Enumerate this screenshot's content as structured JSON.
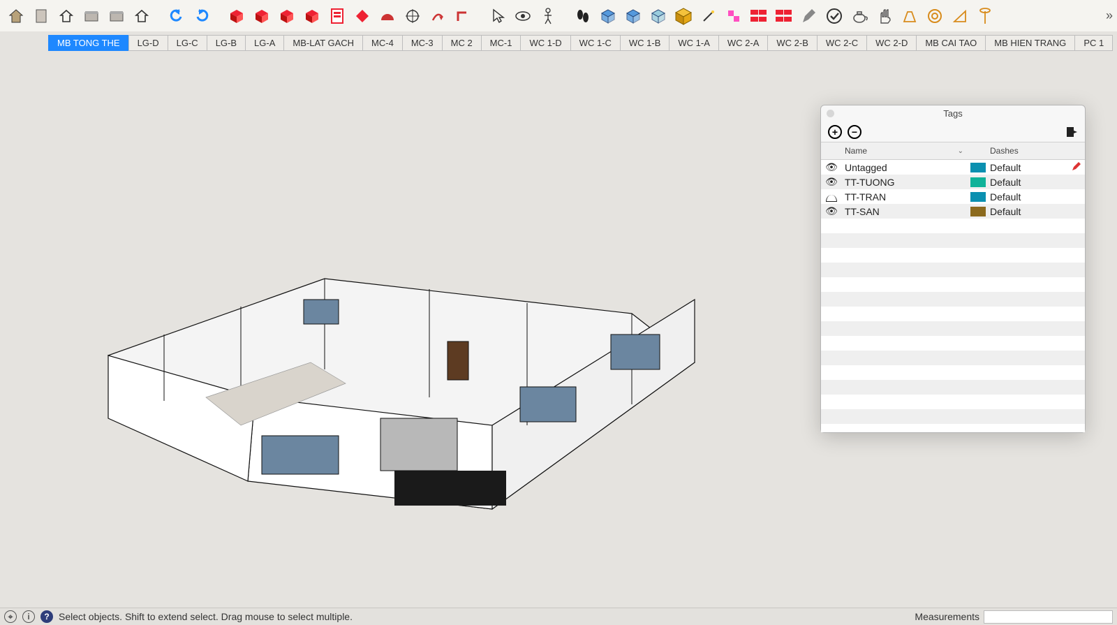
{
  "toolbar": {
    "icons": [
      {
        "name": "model-icon",
        "fill": "#b8a27a",
        "type": "house"
      },
      {
        "name": "open-icon",
        "fill": "#ccc5bc",
        "type": "sheet"
      },
      {
        "name": "home-icon",
        "fill": "#444",
        "type": "house-outline"
      },
      {
        "name": "folder-icon",
        "fill": "#bdb7b0",
        "type": "box"
      },
      {
        "name": "box-icon",
        "fill": "#bdb7b0",
        "type": "box"
      },
      {
        "name": "house-outline-icon",
        "fill": "#444",
        "type": "house-outline"
      },
      {
        "name": "sep"
      },
      {
        "name": "undo-icon",
        "fill": "#1e88ff",
        "type": "arrow-ccw"
      },
      {
        "name": "redo-icon",
        "fill": "#1e88ff",
        "type": "arrow-cw"
      },
      {
        "name": "sep"
      },
      {
        "name": "material-red-icon",
        "fill": "#e23",
        "type": "cube-red"
      },
      {
        "name": "material-green-icon",
        "fill": "#e23",
        "type": "cube-plus"
      },
      {
        "name": "refresh-material-icon",
        "fill": "#e23",
        "type": "cube-arrow"
      },
      {
        "name": "delete-material-icon",
        "fill": "#e23",
        "type": "cube-x"
      },
      {
        "name": "document-red-icon",
        "fill": "#e23",
        "type": "sheet-red"
      },
      {
        "name": "diamond-red-icon",
        "fill": "#e23",
        "type": "diamond"
      },
      {
        "name": "semi-circle-icon",
        "fill": "#c33",
        "type": "semi"
      },
      {
        "name": "target-icon",
        "fill": "#333",
        "type": "target"
      },
      {
        "name": "motion-icon",
        "fill": "#c33",
        "type": "swirl"
      },
      {
        "name": "corner-icon",
        "fill": "#c33",
        "type": "corner"
      },
      {
        "name": "sep"
      },
      {
        "name": "cursor-icon",
        "fill": "#555",
        "type": "cursor"
      },
      {
        "name": "eye-icon",
        "fill": "#555",
        "type": "eye"
      },
      {
        "name": "figure-icon",
        "fill": "#555",
        "type": "figure"
      },
      {
        "name": "sep"
      },
      {
        "name": "footprints-icon",
        "fill": "#222",
        "type": "foot"
      },
      {
        "name": "cube-blue-icon",
        "fill": "#59d",
        "type": "cube-wire"
      },
      {
        "name": "cube-down-icon",
        "fill": "#59d",
        "type": "cube-wire"
      },
      {
        "name": "cube-light-icon",
        "fill": "#9cd",
        "type": "cube-wire"
      },
      {
        "name": "cube-gold-icon",
        "fill": "#e6a817",
        "type": "cube-solid"
      },
      {
        "name": "wand-icon",
        "fill": "#333",
        "type": "wand"
      },
      {
        "name": "pink-boxes-icon",
        "fill": "#ff4fc1",
        "type": "pink"
      },
      {
        "name": "bricks-icon",
        "fill": "#e23",
        "type": "bricks"
      },
      {
        "name": "bricks-arrow-icon",
        "fill": "#e23",
        "type": "bricks"
      },
      {
        "name": "pen-icon",
        "fill": "#888",
        "type": "pen"
      },
      {
        "name": "check-circle-icon",
        "fill": "#333",
        "type": "check"
      },
      {
        "name": "teapot-icon",
        "fill": "#555",
        "type": "teapot"
      },
      {
        "name": "hand-icon",
        "fill": "#555",
        "type": "hand"
      },
      {
        "name": "perspective-icon",
        "fill": "#d88b1b",
        "type": "persp"
      },
      {
        "name": "ring-icon",
        "fill": "#d88b1b",
        "type": "ring"
      },
      {
        "name": "triangle-icon",
        "fill": "#d88b1b",
        "type": "tri"
      },
      {
        "name": "pin-icon",
        "fill": "#d88b1b",
        "type": "pin"
      }
    ]
  },
  "scenes": {
    "tabs": [
      {
        "label": "MB TONG THE",
        "active": true
      },
      {
        "label": "LG-D"
      },
      {
        "label": "LG-C"
      },
      {
        "label": "LG-B"
      },
      {
        "label": "LG-A"
      },
      {
        "label": "MB-LAT GACH"
      },
      {
        "label": "MC-4"
      },
      {
        "label": "MC-3"
      },
      {
        "label": "MC 2"
      },
      {
        "label": "MC-1"
      },
      {
        "label": "WC 1-D"
      },
      {
        "label": "WC 1-C"
      },
      {
        "label": "WC 1-B"
      },
      {
        "label": "WC 1-A"
      },
      {
        "label": "WC 2-A"
      },
      {
        "label": "WC 2-B"
      },
      {
        "label": "WC 2-C"
      },
      {
        "label": "WC 2-D"
      },
      {
        "label": "MB CAI TAO"
      },
      {
        "label": "MB HIEN TRANG"
      },
      {
        "label": "PC 1"
      }
    ]
  },
  "tagsPanel": {
    "title": "Tags",
    "headers": {
      "name": "Name",
      "dashes": "Dashes"
    },
    "rows": [
      {
        "visible": true,
        "name": "Untagged",
        "color": "#0b90b0",
        "dashes": "Default",
        "editing": true
      },
      {
        "visible": true,
        "name": "TT-TUONG",
        "color": "#0fb299",
        "dashes": "Default"
      },
      {
        "visible": false,
        "name": "TT-TRAN",
        "color": "#0b90b0",
        "dashes": "Default"
      },
      {
        "visible": true,
        "name": "TT-SAN",
        "color": "#8b6a1e",
        "dashes": "Default"
      }
    ]
  },
  "statusbar": {
    "hint": "Select objects. Shift to extend select. Drag mouse to select multiple.",
    "measurementsLabel": "Measurements"
  }
}
